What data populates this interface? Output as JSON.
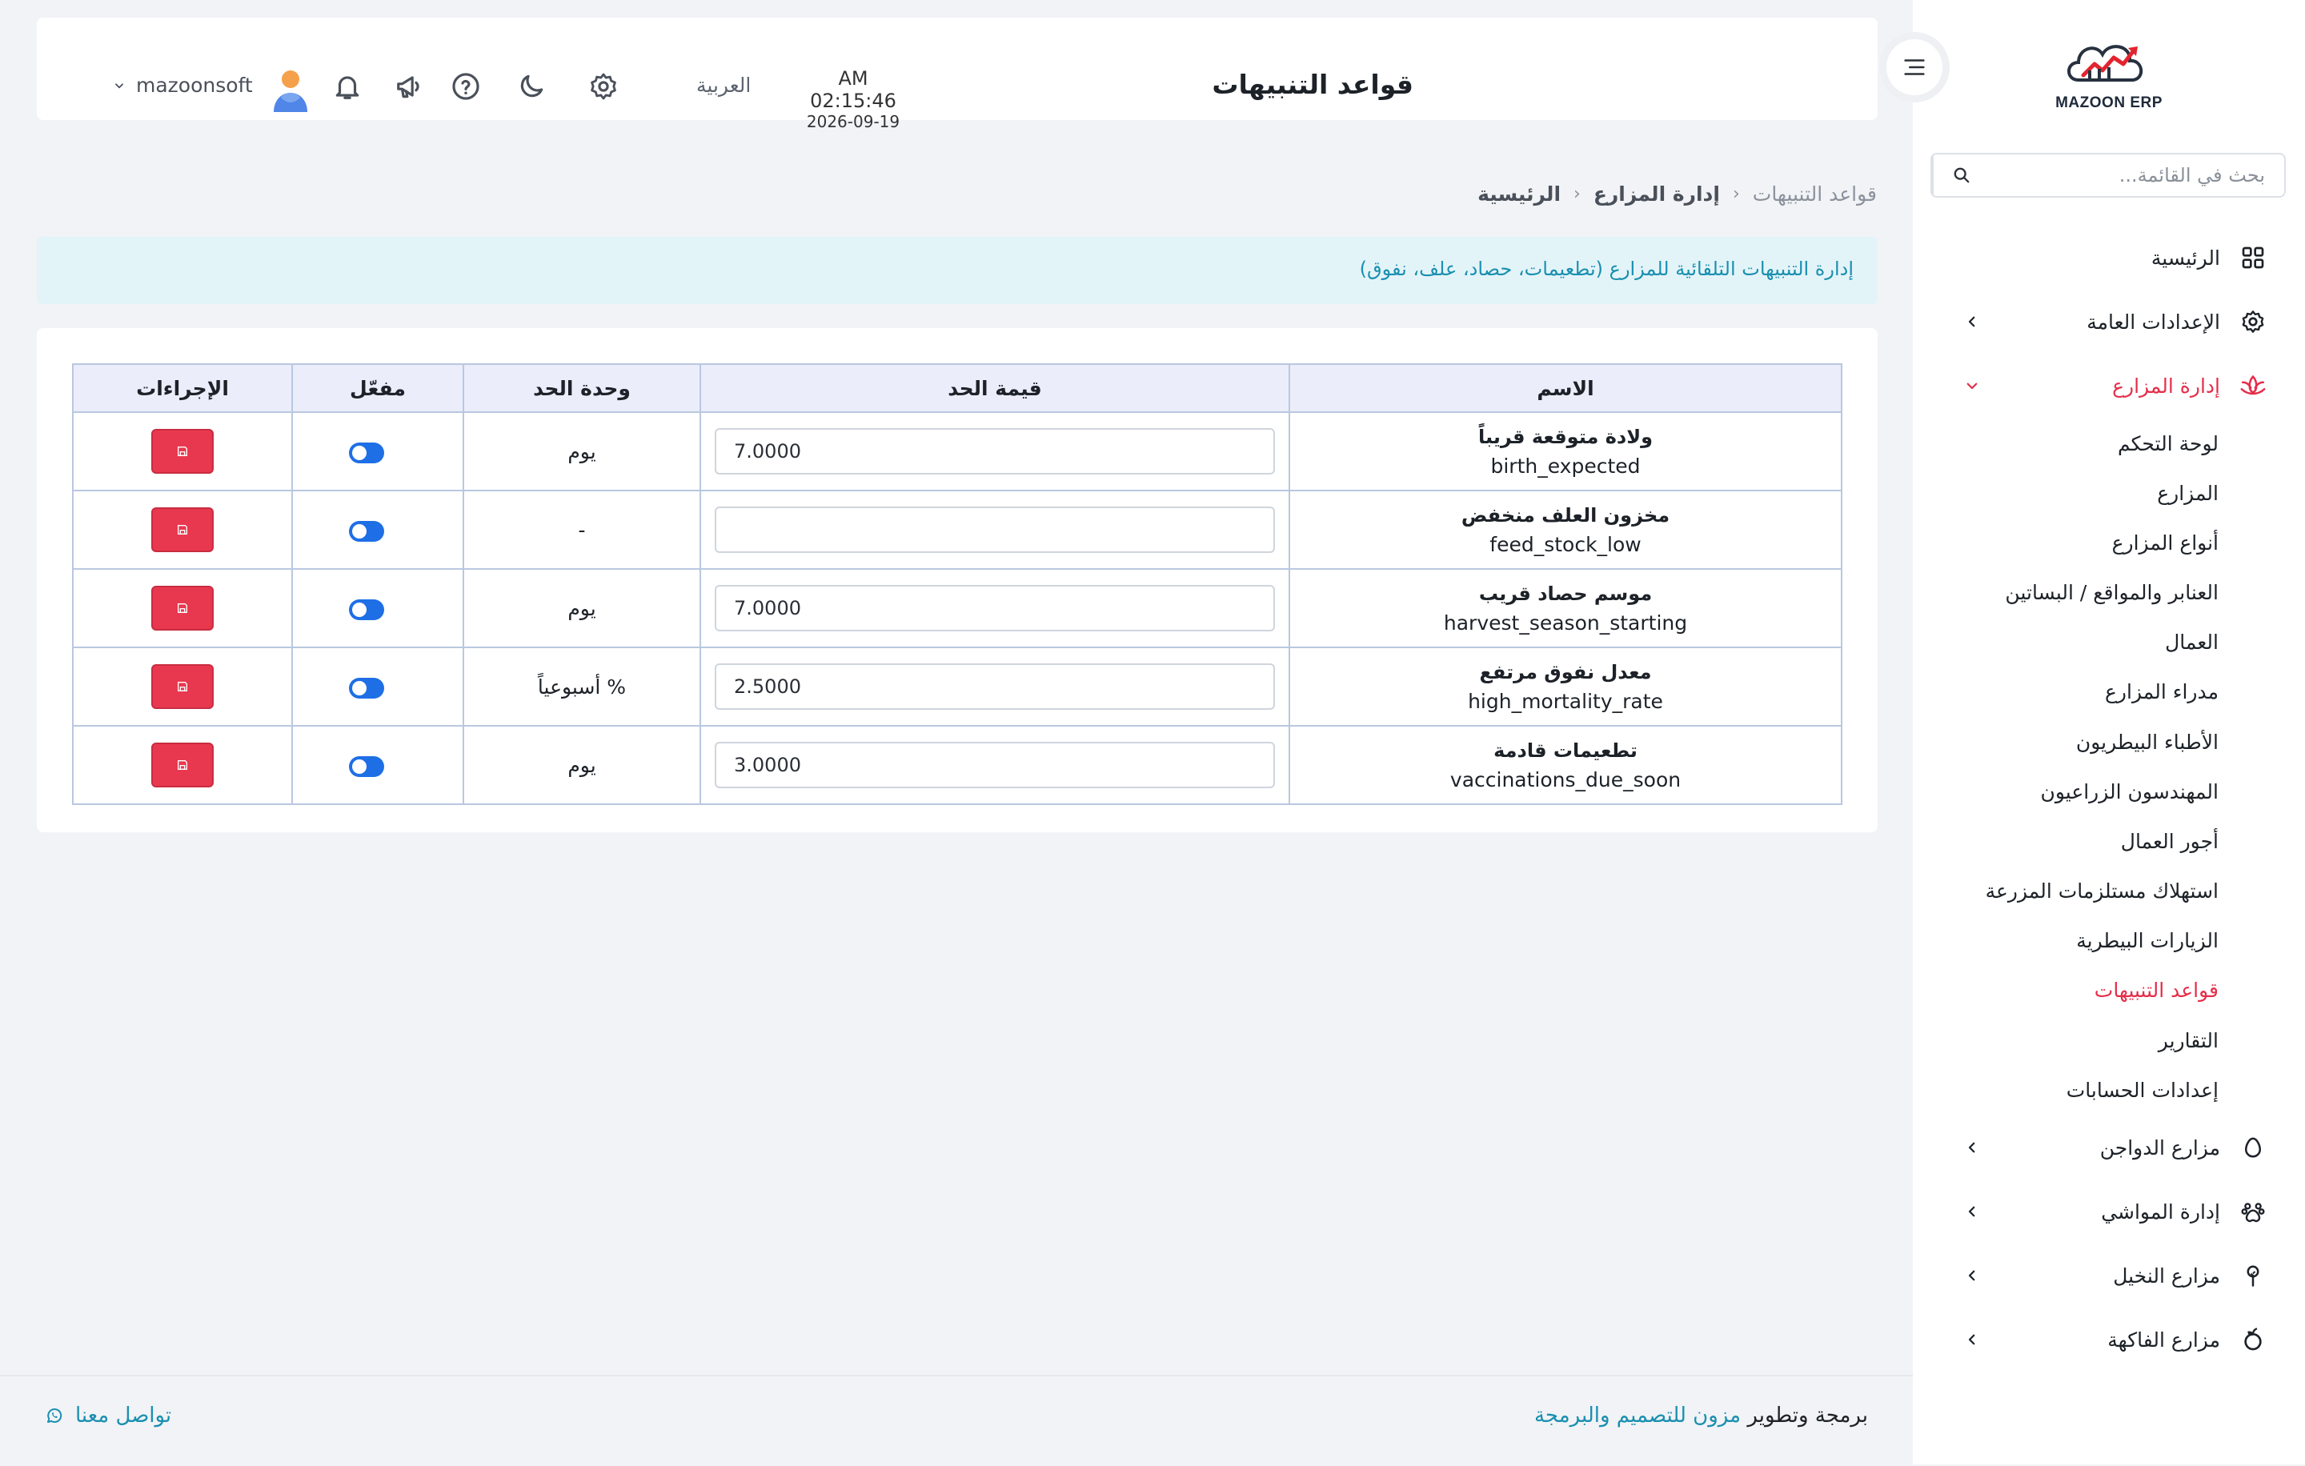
{
  "sidebar": {
    "logo_text": "MAZOON ERP",
    "search_placeholder": "بحث في القائمة...",
    "items": [
      {
        "label": "الرئيسية",
        "icon": "grid-icon"
      },
      {
        "label": "الإعدادات العامة",
        "icon": "gear-icon"
      },
      {
        "label": "إدارة المزارع",
        "icon": "lotus-icon"
      },
      {
        "label": "مزارع الدواجن",
        "icon": "egg-icon"
      },
      {
        "label": "إدارة المواشي",
        "icon": "paw-icon"
      },
      {
        "label": "مزارع النخيل",
        "icon": "plant-icon"
      },
      {
        "label": "مزارع الفاكهة",
        "icon": "fruit-icon"
      }
    ],
    "sub_items": [
      "لوحة التحكم",
      "المزارع",
      "أنواع المزارع",
      "العنابر والمواقع / البساتين",
      "العمال",
      "مدراء المزارع",
      "الأطباء البيطريون",
      "المهندسون الزراعيون",
      "أجور العمال",
      "استهلاك مستلزمات المزرعة",
      "الزيارات البيطرية",
      "قواعد التنبيهات",
      "التقارير",
      "إعدادات الحسابات"
    ],
    "active_sub": "قواعد التنبيهات"
  },
  "header": {
    "title": "قواعد التنبيهات",
    "time": "AM 02:15:46",
    "date": "2026-09-19",
    "language": "العربية",
    "username": "mazoonsoft"
  },
  "breadcrumb": [
    "الرئيسية",
    "إدارة المزارع",
    "قواعد التنبيهات"
  ],
  "banner": "إدارة التنبيهات التلقائية للمزارع (تطعيمات، حصاد، علف، نفوق)",
  "table": {
    "headers": [
      "الاسم",
      "قيمة الحد",
      "وحدة الحد",
      "مفعّل",
      "الإجراءات"
    ],
    "rows": [
      {
        "name": "ولادة متوقعة قريباً",
        "code": "birth_expected",
        "value": "7.0000",
        "unit": "يوم",
        "enabled": true
      },
      {
        "name": "مخزون العلف منخفض",
        "code": "feed_stock_low",
        "value": "",
        "unit": "-",
        "enabled": true
      },
      {
        "name": "موسم حصاد قريب",
        "code": "harvest_season_starting",
        "value": "7.0000",
        "unit": "يوم",
        "enabled": true
      },
      {
        "name": "معدل نفوق مرتفع",
        "code": "high_mortality_rate",
        "value": "2.5000",
        "unit": "% أسبوعياً",
        "enabled": true
      },
      {
        "name": "تطعيمات قادمة",
        "code": "vaccinations_due_soon",
        "value": "3.0000",
        "unit": "يوم",
        "enabled": true
      }
    ]
  },
  "footer": {
    "credit_prefix": "برمجة وتطوير",
    "credit_brand": "مزون للتصميم والبرمجة",
    "contact": "تواصل معنا"
  },
  "colors": {
    "accent": "#e52e4a",
    "link": "#1a8fb0",
    "toggle": "#1e6fe6",
    "table_header": "#ecedfb"
  }
}
